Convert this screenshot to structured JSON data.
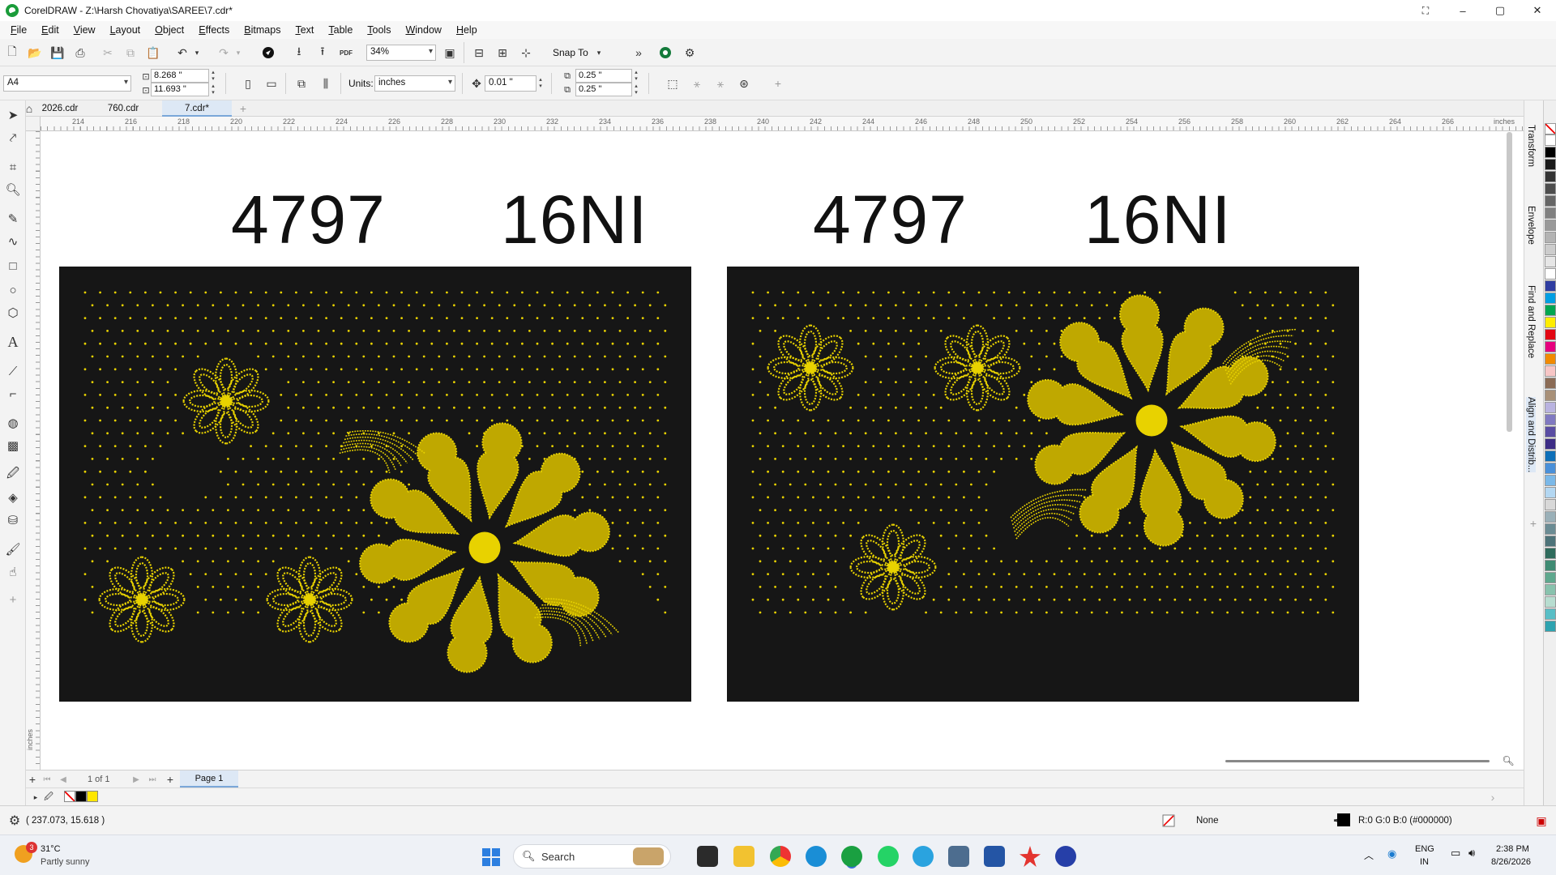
{
  "window": {
    "title": "CorelDRAW - Z:\\Harsh Chovatiya\\SAREE\\7.cdr*",
    "controls": {
      "minimize": "–",
      "restore": "▢",
      "close": "✕"
    }
  },
  "menu": [
    "File",
    "Edit",
    "View",
    "Layout",
    "Object",
    "Effects",
    "Bitmaps",
    "Text",
    "Table",
    "Tools",
    "Window",
    "Help"
  ],
  "toolbar": {
    "zoom": "34%",
    "snap_to": "Snap To",
    "pdf_label": "PDF"
  },
  "property_bar": {
    "page_size": "A4",
    "width": "8.268 \"",
    "height": "11.693 \"",
    "units_label": "Units:",
    "units": "inches",
    "nudge": "0.01 \"",
    "dup_x": "0.25 \"",
    "dup_y": "0.25 \""
  },
  "tabs": [
    {
      "label": "2026.cdr",
      "active": false
    },
    {
      "label": "760.cdr",
      "active": false
    },
    {
      "label": "7.cdr*",
      "active": true
    }
  ],
  "ruler": {
    "ticks": [
      "214",
      "216",
      "218",
      "220",
      "222",
      "224",
      "226",
      "228",
      "230",
      "232",
      "234",
      "236",
      "238",
      "240",
      "242",
      "244",
      "246",
      "248",
      "250",
      "252",
      "254",
      "256",
      "258",
      "260",
      "262",
      "264",
      "266"
    ],
    "unit": "inches",
    "vertical_unit": "inches"
  },
  "canvas": {
    "left_code": "4797",
    "left_code2": "16NI",
    "right_code": "4797",
    "right_code2": "16NI",
    "panel_color": "#161616",
    "motif_color": "#e8d200"
  },
  "dockers": [
    "Transform",
    "Envelope",
    "Find and Replace",
    "Align and Distrib..."
  ],
  "palette": [
    "#ffffff",
    "#000000",
    "#1a1a1a",
    "#333333",
    "#4d4d4d",
    "#666666",
    "#808080",
    "#999999",
    "#b3b3b3",
    "#cccccc",
    "#e6e6e6",
    "#ffffff",
    "#2f3da1",
    "#009fe3",
    "#00a650",
    "#ffed00",
    "#e30613",
    "#e6007e",
    "#f18a00",
    "#f7c6c6",
    "#8b6b55",
    "#a89078",
    "#b9b3e0",
    "#8079c1",
    "#5a4da3",
    "#3d2d86",
    "#0e6fb8",
    "#4a90d9",
    "#7ab8e8",
    "#b3d7f2",
    "#d8d8d8",
    "#9ab0b8",
    "#6b8c94",
    "#4d7379",
    "#2e6b5c",
    "#3f8b73",
    "#5fa88e",
    "#88c2ad",
    "#b7ddd0",
    "#58bec6",
    "#2ea3b0"
  ],
  "page_nav": {
    "count": "1 of 1",
    "page_tab": "Page 1"
  },
  "status": {
    "coords": "( 237.073, 15.618 )",
    "fill": "None",
    "outline": "R:0 G:0 B:0 (#000000)"
  },
  "taskbar": {
    "weather_temp": "31°C",
    "weather_desc": "Partly sunny",
    "weather_badge": "3",
    "search_placeholder": "Search",
    "lang1": "ENG",
    "lang2": "IN",
    "time": "2:38 PM",
    "date": "8/26/2026"
  }
}
